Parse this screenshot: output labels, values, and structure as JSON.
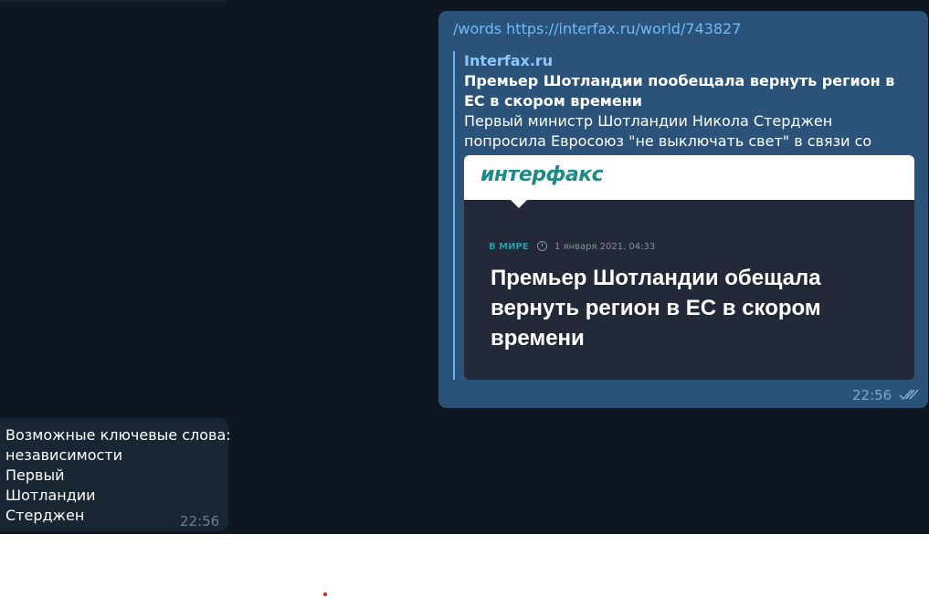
{
  "outgoing_message": {
    "command": "/words",
    "link": "https://interfax.ru/world/743827",
    "time": "22:56"
  },
  "link_preview": {
    "site_name": "Interfax.ru",
    "title": "Премьер Шотландии пообещала вернуть регион в ЕС в скором времени",
    "description": "Первый министр Шотландии Никола Стерджен попросила Евросоюз \"не выключать свет\" в связи со скорым возвращен...",
    "image": {
      "logo_text": "интерфакс",
      "category": "В МИРЕ",
      "date": "1 января 2021, 04:33",
      "headline": "Премьер Шотландии обещала вернуть регион в ЕС в скором времени"
    }
  },
  "incoming_message": {
    "lines": [
      "Возможные ключевые слова:",
      "независимости",
      "Первый",
      "Шотландии",
      "Стерджен"
    ],
    "time": "22:56"
  },
  "colors": {
    "chat_background": "#0e1621",
    "outgoing_bubble": "#2b5278",
    "incoming_bubble": "#182533",
    "link": "#71baf5",
    "accent": "#6ab3f3"
  }
}
